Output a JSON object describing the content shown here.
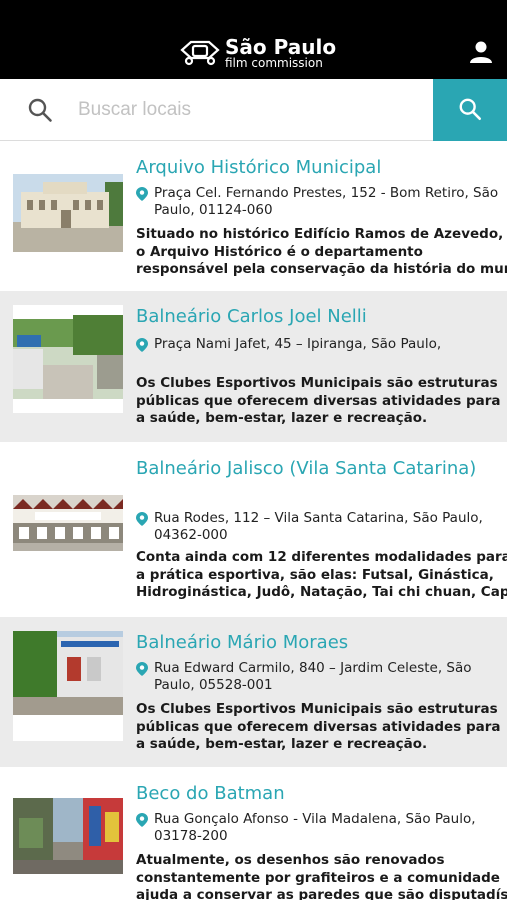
{
  "header": {
    "logo_title": "São Paulo",
    "logo_subtitle": "film commission",
    "user_icon": "user-icon"
  },
  "search": {
    "placeholder": "Buscar locais",
    "value": "",
    "left_icon": "search-icon",
    "button_icon": "search-icon"
  },
  "colors": {
    "accent": "#2aa6b3",
    "header_bg": "#000000",
    "alt_row_bg": "#ebebeb"
  },
  "items": [
    {
      "title": "Arquivo Histórico Municipal",
      "address": "Praça Cel. Fernando Prestes, 152 - Bom Retiro, São Paulo, 01124-060",
      "description": [
        "Situado no histórico Edifício Ramos de Azevedo,",
        "o Arquivo Histórico é o departamento",
        "responsável pela conservação da história do município"
      ]
    },
    {
      "title": "Balneário Carlos Joel Nelli",
      "address": "Praça Nami Jafet, 45 – Ipiranga, São Paulo,",
      "description": [
        "Os Clubes Esportivos Municipais são estruturas",
        "públicas que oferecem diversas atividades para",
        "a saúde, bem-estar, lazer e recreação."
      ]
    },
    {
      "title": "Balneário Jalisco (Vila Santa Catarina)",
      "address": "Rua Rodes, 112 – Vila Santa Catarina, São Paulo, 04362-000",
      "description": [
        "Conta ainda com 12 diferentes modalidades para",
        "a prática esportiva, são elas: Futsal, Ginástica,",
        "Hidroginástica, Judô, Natação, Tai chi chuan, Capoeira"
      ]
    },
    {
      "title": "Balneário Mário Moraes",
      "address": "Rua Edward Carmilo, 840 – Jardim Celeste, São Paulo, 05528-001",
      "description": [
        "Os Clubes Esportivos Municipais são estruturas",
        "públicas que oferecem diversas atividades para",
        "a saúde, bem-estar, lazer e recreação."
      ]
    },
    {
      "title": "Beco do Batman",
      "address": "Rua Gonçalo Afonso - Vila Madalena, São Paulo, 03178-200",
      "description": [
        "Atualmente, os desenhos são renovados",
        "constantemente por grafiteiros e a comunidade",
        "ajuda a conservar as paredes que são disputadíssimas"
      ]
    }
  ]
}
